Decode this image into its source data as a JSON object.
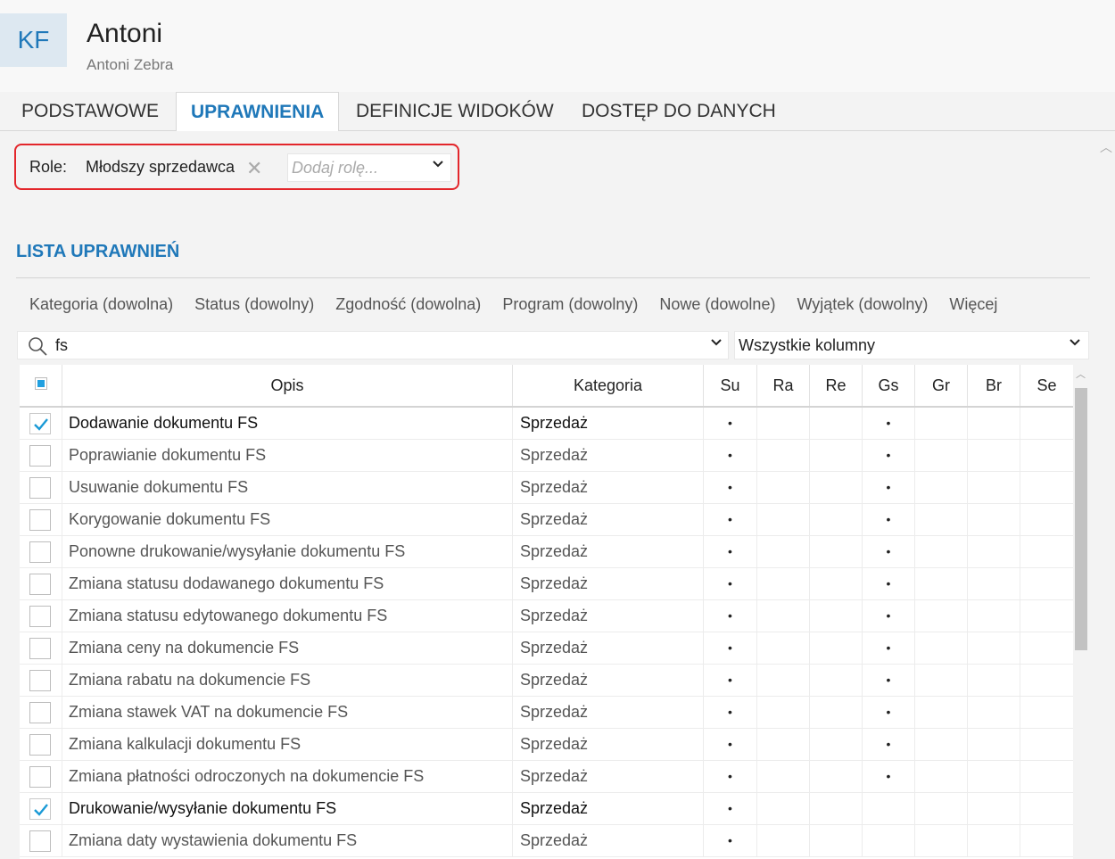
{
  "header": {
    "avatar_initials": "KF",
    "name": "Antoni",
    "subtitle": "Antoni Zebra"
  },
  "tabs": [
    {
      "label": "PODSTAWOWE",
      "active": false
    },
    {
      "label": "UPRAWNIENIA",
      "active": true
    },
    {
      "label": "DEFINICJE WIDOKÓW",
      "active": false
    },
    {
      "label": "DOSTĘP DO DANYCH",
      "active": false
    }
  ],
  "roles": {
    "label": "Role:",
    "selected": "Młodszy sprzedawca",
    "placeholder": "Dodaj rolę..."
  },
  "section_title": "LISTA UPRAWNIEŃ",
  "filters": [
    "Kategoria (dowolna)",
    "Status (dowolny)",
    "Zgodność (dowolna)",
    "Program (dowolny)",
    "Nowe (dowolne)",
    "Wyjątek (dowolny)",
    "Więcej"
  ],
  "search": {
    "value": "fs"
  },
  "columns_select": {
    "value": "Wszystkie kolumny"
  },
  "table": {
    "headers": {
      "opis": "Opis",
      "kategoria": "Kategoria",
      "flags": [
        "Su",
        "Ra",
        "Re",
        "Gs",
        "Gr",
        "Br",
        "Se"
      ]
    },
    "flag_symbol": "•",
    "rows": [
      {
        "checked": true,
        "opis": "Dodawanie dokumentu FS",
        "kategoria": "Sprzedaż",
        "flags": [
          1,
          0,
          0,
          1,
          0,
          0,
          0
        ]
      },
      {
        "checked": false,
        "opis": "Poprawianie dokumentu FS",
        "kategoria": "Sprzedaż",
        "flags": [
          1,
          0,
          0,
          1,
          0,
          0,
          0
        ]
      },
      {
        "checked": false,
        "opis": "Usuwanie dokumentu FS",
        "kategoria": "Sprzedaż",
        "flags": [
          1,
          0,
          0,
          1,
          0,
          0,
          0
        ]
      },
      {
        "checked": false,
        "opis": "Korygowanie dokumentu FS",
        "kategoria": "Sprzedaż",
        "flags": [
          1,
          0,
          0,
          1,
          0,
          0,
          0
        ]
      },
      {
        "checked": false,
        "opis": "Ponowne drukowanie/wysyłanie dokumentu FS",
        "kategoria": "Sprzedaż",
        "flags": [
          1,
          0,
          0,
          1,
          0,
          0,
          0
        ]
      },
      {
        "checked": false,
        "opis": "Zmiana statusu dodawanego dokumentu FS",
        "kategoria": "Sprzedaż",
        "flags": [
          1,
          0,
          0,
          1,
          0,
          0,
          0
        ]
      },
      {
        "checked": false,
        "opis": "Zmiana statusu edytowanego dokumentu FS",
        "kategoria": "Sprzedaż",
        "flags": [
          1,
          0,
          0,
          1,
          0,
          0,
          0
        ]
      },
      {
        "checked": false,
        "opis": "Zmiana ceny na dokumencie FS",
        "kategoria": "Sprzedaż",
        "flags": [
          1,
          0,
          0,
          1,
          0,
          0,
          0
        ]
      },
      {
        "checked": false,
        "opis": "Zmiana rabatu na dokumencie FS",
        "kategoria": "Sprzedaż",
        "flags": [
          1,
          0,
          0,
          1,
          0,
          0,
          0
        ]
      },
      {
        "checked": false,
        "opis": "Zmiana stawek VAT na dokumencie FS",
        "kategoria": "Sprzedaż",
        "flags": [
          1,
          0,
          0,
          1,
          0,
          0,
          0
        ]
      },
      {
        "checked": false,
        "opis": "Zmiana kalkulacji dokumentu FS",
        "kategoria": "Sprzedaż",
        "flags": [
          1,
          0,
          0,
          1,
          0,
          0,
          0
        ]
      },
      {
        "checked": false,
        "opis": "Zmiana płatności odroczonych na dokumencie FS",
        "kategoria": "Sprzedaż",
        "flags": [
          1,
          0,
          0,
          1,
          0,
          0,
          0
        ]
      },
      {
        "checked": true,
        "opis": "Drukowanie/wysyłanie dokumentu FS",
        "kategoria": "Sprzedaż",
        "flags": [
          1,
          0,
          0,
          0,
          0,
          0,
          0
        ]
      },
      {
        "checked": false,
        "opis": "Zmiana daty wystawienia dokumentu FS",
        "kategoria": "Sprzedaż",
        "flags": [
          1,
          0,
          0,
          0,
          0,
          0,
          0
        ]
      }
    ]
  },
  "colors": {
    "accent": "#1f78b9",
    "highlight_border": "#e3262b",
    "checkmark": "#1a9ad6"
  }
}
